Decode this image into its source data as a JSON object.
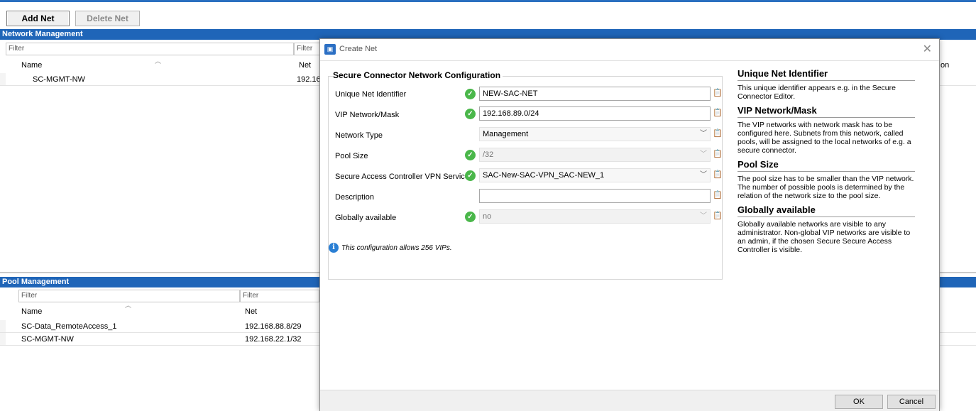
{
  "toolbar": {
    "add_net": "Add Net",
    "delete_net": "Delete Net"
  },
  "network_management": {
    "title": "Network Management",
    "filter_placeholder": "Filter",
    "filter2_placeholder": "Filter",
    "col_name": "Name",
    "col_net": "Net",
    "col_partial_right": "on",
    "rows": [
      {
        "name": "SC-MGMT-NW",
        "net": "192.16"
      }
    ]
  },
  "pool_management": {
    "title": "Pool Management",
    "filter_placeholder": "Filter",
    "filter2_placeholder": "Filter",
    "col_name": "Name",
    "col_net": "Net",
    "rows": [
      {
        "name": "SC-Data_RemoteAccess_1",
        "net": "192.168.88.8/29"
      },
      {
        "name": "SC-MGMT-NW",
        "net": "192.168.22.1/32"
      }
    ]
  },
  "dialog": {
    "title": "Create Net",
    "group_title": "Secure Connector Network Configuration",
    "fields": {
      "uid_label": "Unique Net Identifier",
      "uid_value": "NEW-SAC-NET",
      "vip_label": "VIP Network/Mask",
      "vip_value": "192.168.89.0/24",
      "type_label": "Network Type",
      "type_value": "Management",
      "pool_label": "Pool Size",
      "pool_value": "/32",
      "sac_label": "Secure Access Controller VPN Service",
      "sac_value": "SAC-New-SAC-VPN_SAC-NEW_1",
      "desc_label": "Description",
      "desc_value": "",
      "glob_label": "Globally available",
      "glob_value": "no"
    },
    "info_text": "This configuration allows 256 VIPs.",
    "help": {
      "uid_title": "Unique Net Identifier",
      "uid_text": "This unique identifier appears e.g. in the Secure Connector Editor.",
      "vip_title": "VIP Network/Mask",
      "vip_text": "The VIP networks with network mask has to be configured here. Subnets from this network, called pools, will be assigned to the local networks of e.g. a secure connector.",
      "pool_title": "Pool Size",
      "pool_text": "The pool size has to be smaller than the VIP network. The number of possible pools is determined by the relation of the network size to the pool size.",
      "glob_title": "Globally available",
      "glob_text": "Globally available networks are visible to any administrator. Non-global VIP networks are visible to an admin, if the chosen Secure Secure Access Controller is visible."
    },
    "ok": "OK",
    "cancel": "Cancel"
  },
  "colors": {
    "accent": "#1f65b8",
    "check": "#4ab74a",
    "info": "#2a7fd4"
  }
}
